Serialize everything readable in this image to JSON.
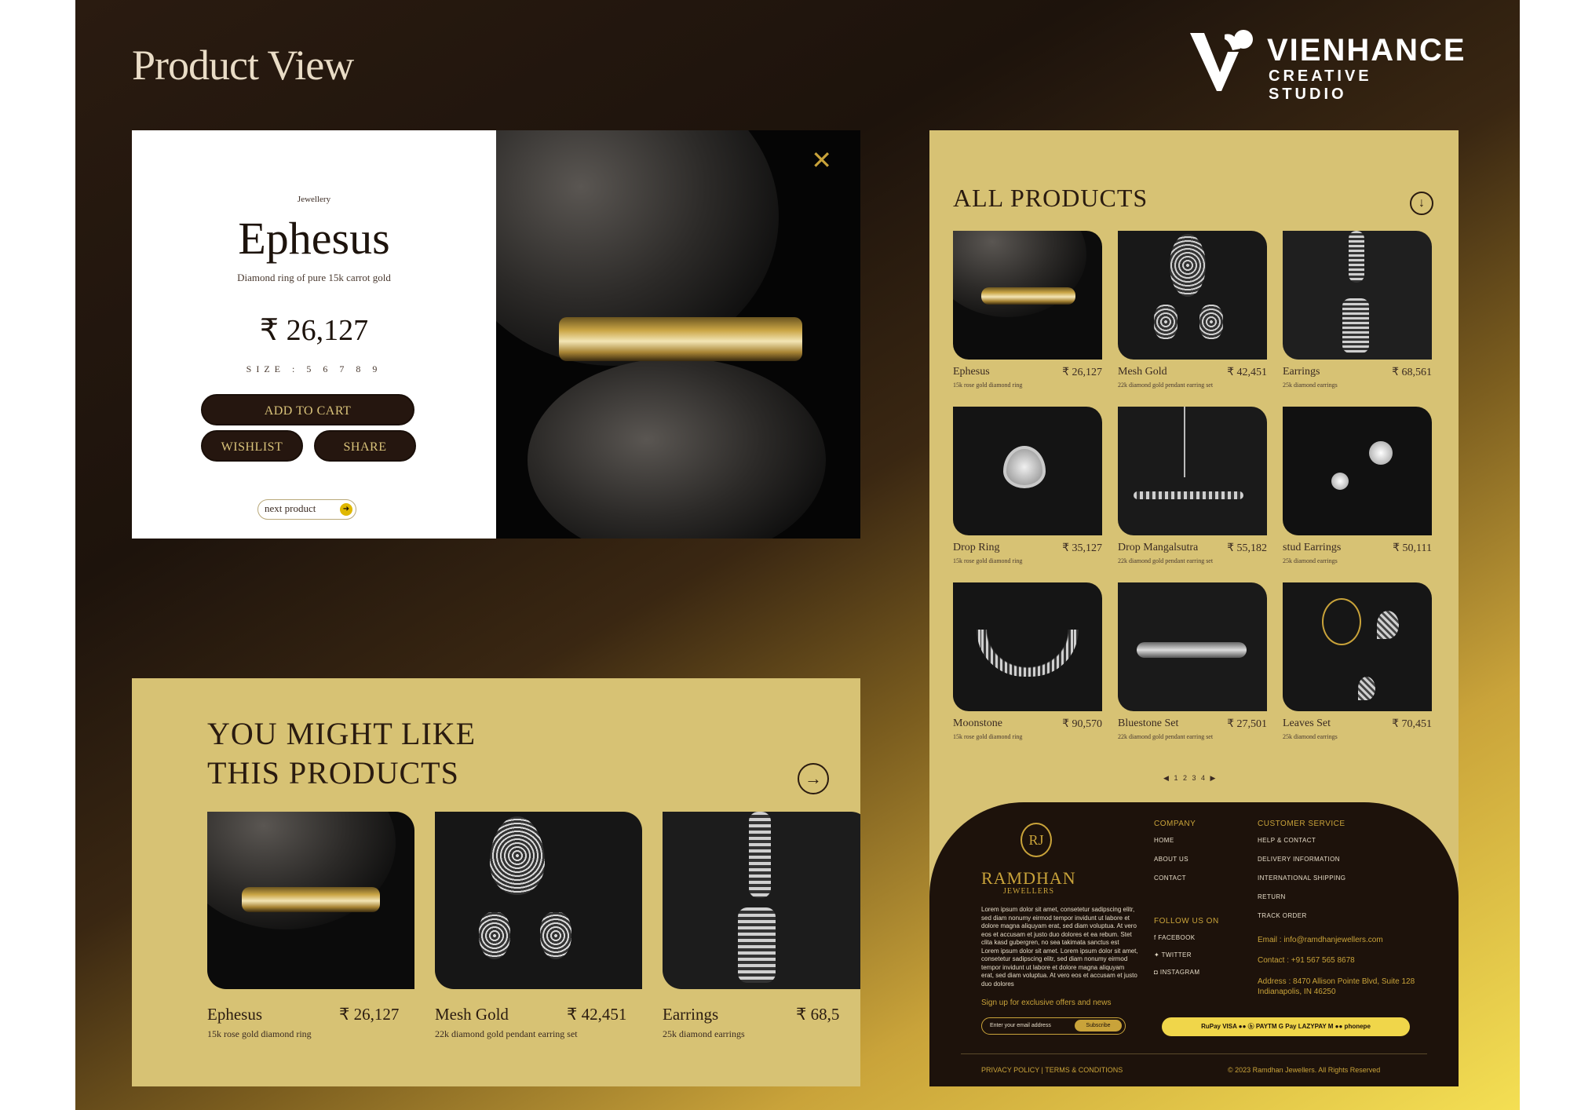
{
  "heading": {
    "title": "Product View"
  },
  "logo": {
    "name": "VIENHANCE",
    "subtitle": "CREATIVE STUDIO"
  },
  "product": {
    "category": "Jewellery",
    "name": "Ephesus",
    "description": "Diamond ring of pure 15k carrot gold",
    "price": "₹ 26,127",
    "size_label": "SIZE :",
    "sizes": [
      "5",
      "6",
      "7",
      "8",
      "9"
    ],
    "add_to_cart": "ADD TO CART",
    "wishlist": "WISHLIST",
    "share": "SHARE",
    "next": "next product",
    "close_icon": "close-icon"
  },
  "recommend": {
    "title_line1": "YOU MIGHT LIKE",
    "title_line2": "THIS PRODUCTS",
    "items": [
      {
        "name": "Ephesus",
        "price": "₹ 26,127",
        "desc": "15k rose gold diamond ring"
      },
      {
        "name": "Mesh Gold",
        "price": "₹ 42,451",
        "desc": "22k diamond gold pendant earring set"
      },
      {
        "name": "Earrings",
        "price": "₹ 68,5",
        "desc": "25k diamond earrings"
      }
    ]
  },
  "all_products": {
    "title": "ALL PRODUCTS",
    "items": [
      {
        "name": "Ephesus",
        "price": "₹ 26,127",
        "desc": "15k rose gold diamond ring"
      },
      {
        "name": "Mesh Gold",
        "price": "₹ 42,451",
        "desc": "22k diamond gold pendant earring set"
      },
      {
        "name": "Earrings",
        "price": "₹ 68,561",
        "desc": "25k diamond earrings"
      },
      {
        "name": "Drop Ring",
        "price": "₹ 35,127",
        "desc": "15k rose gold diamond ring"
      },
      {
        "name": "Drop Mangalsutra",
        "price": "₹ 55,182",
        "desc": "22k diamond gold pendant earring set"
      },
      {
        "name": "stud Earrings",
        "price": "₹ 50,111",
        "desc": "25k diamond earrings"
      },
      {
        "name": "Moonstone",
        "price": "₹ 90,570",
        "desc": "15k rose gold diamond ring"
      },
      {
        "name": "Bluestone Set",
        "price": "₹ 27,501",
        "desc": "22k diamond gold pendant earring set"
      },
      {
        "name": "Leaves Set",
        "price": "₹ 70,451",
        "desc": "25k diamond earrings"
      }
    ],
    "pages": "1 2 3 4"
  },
  "footer": {
    "brand_mono": "RJ",
    "brand_name": "RAMDHAN",
    "brand_sub": "JEWELLERS",
    "about": "Lorem ipsum dolor sit amet, consetetur sadipscing elitr, sed diam nonumy eirmod tempor invidunt ut labore et dolore magna aliquyam erat, sed diam voluptua. At vero eos et accusam et justo duo dolores et ea rebum. Stet clita kasd gubergren, no sea takimata sanctus est Lorem ipsum dolor sit amet. Lorem ipsum dolor sit amet, consetetur sadipscing elitr, sed diam nonumy eirmod tempor invidunt ut labore et dolore magna aliquyam erat, sed diam voluptua. At vero eos et accusam et justo duo dolores",
    "signup": "Sign up for exclusive offers and news",
    "email_placeholder": "Enter your email address",
    "subscribe": "Subscribe",
    "company_h": "COMPANY",
    "company": [
      "HOME",
      "ABOUT US",
      "CONTACT"
    ],
    "follow_h": "FOLLOW US ON",
    "follow": [
      "FACEBOOK",
      "TWITTER",
      "INSTAGRAM"
    ],
    "service_h": "CUSTOMER SERVICE",
    "service": [
      "HELP & CONTACT",
      "DELIVERY INFORMATION",
      "INTERNATIONAL SHIPPING",
      "RETURN",
      "TRACK ORDER"
    ],
    "email": "Email : info@ramdhanjewellers.com",
    "contact": "Contact : +91 567 565 8678",
    "address": "Address : 8470 Allison Pointe Blvd, Suite 128 Indianapolis, IN 46250",
    "payments": "RuPay  VISA  ●●  ⓑ  PAYTM  G Pay  LAZYPAY  M  ●●  phonepe",
    "policy": "PRIVACY POLICY  |  TERMS & CONDITIONS",
    "copyright": "© 2023 Ramdhan Jewellers. All Rights Reserved"
  }
}
